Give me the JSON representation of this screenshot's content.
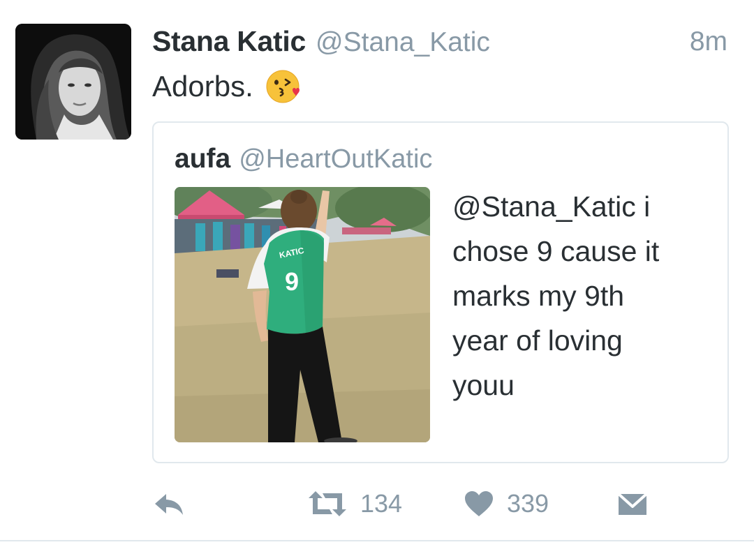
{
  "tweet": {
    "author": {
      "display_name": "Stana Katic",
      "handle": "@Stana_Katic",
      "avatar_icon": "profile-photo"
    },
    "timestamp": "8m",
    "text": "Adorbs.",
    "emoji": "face-throwing-kiss-icon"
  },
  "quoted_tweet": {
    "display_name": "aufa",
    "handle": "@HeartOutKatic",
    "text_lines": [
      "@Stana_Katic i",
      "chose 9 cause it",
      "marks my 9th",
      "year of loving",
      "youu"
    ],
    "photo": {
      "jersey_name": "KATIC",
      "jersey_number": "9"
    }
  },
  "actions": {
    "reply_icon": "reply-icon",
    "retweet_icon": "retweet-icon",
    "retweet_count": "134",
    "like_icon": "heart-icon",
    "like_count": "339",
    "dm_icon": "envelope-icon"
  },
  "colors": {
    "text": "#292f33",
    "secondary": "#8899a6",
    "border": "#e1e8ed",
    "jersey_green": "#2fae7d"
  }
}
